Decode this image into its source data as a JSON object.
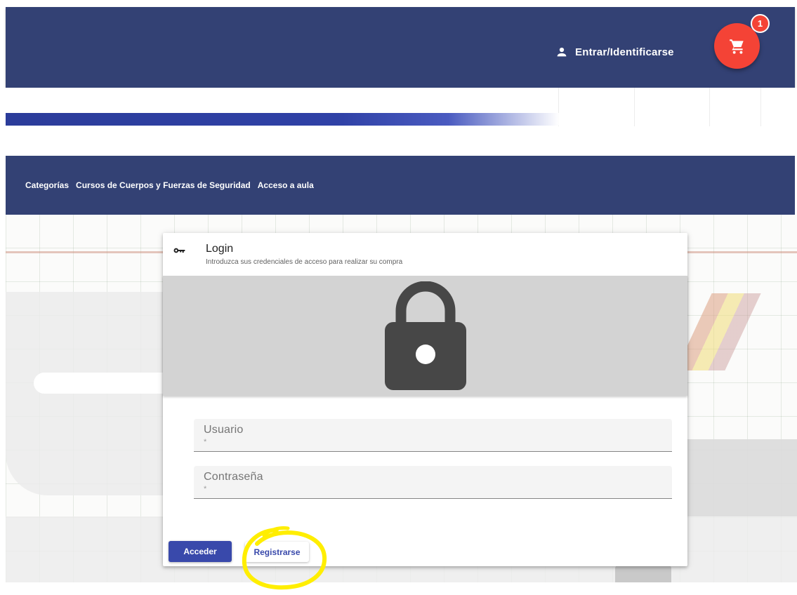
{
  "header": {
    "login_label": "Entrar/Identificarse",
    "cart_count": "1"
  },
  "nav": {
    "items": [
      {
        "label": "Categorías"
      },
      {
        "label": "Cursos de Cuerpos y Fuerzas de Seguridad"
      },
      {
        "label": "Acceso a aula"
      }
    ]
  },
  "login_card": {
    "title": "Login",
    "subtitle": "Introduzca sus credenciales de acceso para realizar su compra",
    "username_label": "Usuario",
    "username_required": "*",
    "password_label": "Contraseña",
    "password_required": "*",
    "submit_label": "Acceder",
    "register_label": "Registrarse"
  },
  "icons": {
    "user": "person-icon",
    "cart": "shopping-cart-icon",
    "key": "key-icon",
    "lock": "lock-icon"
  },
  "colors": {
    "header_bg": "#334174",
    "cart_bg": "#f44336",
    "primary": "#3949ab",
    "highlight": "#ffeb00"
  }
}
